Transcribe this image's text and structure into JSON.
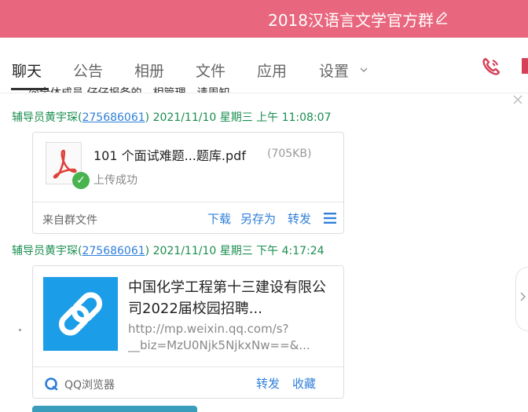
{
  "window": {
    "title": "2018汉语言文学官方群"
  },
  "tabs": [
    {
      "label": "聊天"
    },
    {
      "label": "公告"
    },
    {
      "label": "相册"
    },
    {
      "label": "文件"
    },
    {
      "label": "应用"
    },
    {
      "label": "设置"
    }
  ],
  "chat": {
    "partial_prev_line": "@全体成员 仔仔报备的，相管理，请周知。",
    "messages": [
      {
        "sender": "辅导员黄宇琛",
        "qq_open": "(",
        "qq": "275686061",
        "qq_close": ")",
        "datetime": "2021/11/10 星期三 上午 11:08:07",
        "file": {
          "icon": "pdf-icon",
          "name": "101 个面试难题...题库.pdf",
          "size": "(705KB)",
          "status": "上传成功",
          "source": "来自群文件",
          "actions": [
            "下载",
            "另存为",
            "转发"
          ]
        }
      },
      {
        "sender": "辅导员黄宇琛",
        "qq_open": "(",
        "qq": "275686061",
        "qq_close": ")",
        "datetime": "2021/11/10 星期三 下午 4:17:24",
        "link": {
          "title": "中国化学工程第十三建设有限公司2022届校园招聘...",
          "url": "http://mp.weixin.qq.com/s?__biz=MzU0Njk5NjkxNw==&...",
          "source": "QQ浏览器",
          "actions": [
            "转发",
            "收藏"
          ]
        }
      }
    ]
  },
  "colors": {
    "accent": "#e8677e",
    "sender": "#1a8d4f",
    "link": "#2f7fd9"
  }
}
